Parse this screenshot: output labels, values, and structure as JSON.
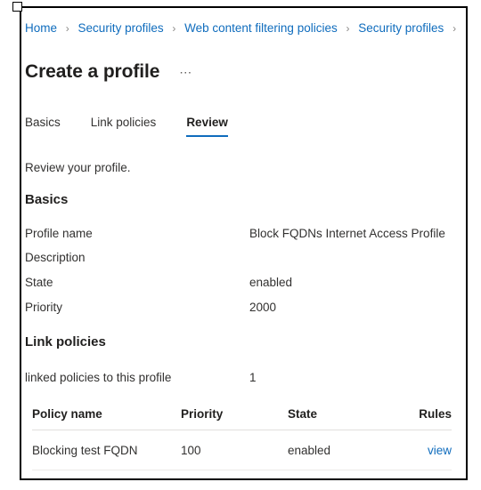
{
  "window": {
    "frame_color": "#000000",
    "accent_color": "#0f6cbd"
  },
  "breadcrumb": {
    "items": [
      {
        "label": "Home"
      },
      {
        "label": "Security profiles"
      },
      {
        "label": "Web content filtering policies"
      },
      {
        "label": "Security profiles"
      }
    ],
    "separator": "›",
    "trailing_separator": "›"
  },
  "header": {
    "title": "Create a profile",
    "more_label": "⋯"
  },
  "tabs": [
    {
      "label": "Basics",
      "active": false
    },
    {
      "label": "Link policies",
      "active": false
    },
    {
      "label": "Review",
      "active": true
    }
  ],
  "main": {
    "intro": "Review your profile.",
    "basics": {
      "heading": "Basics",
      "rows": [
        {
          "key": "Profile name",
          "value": "Block FQDNs Internet Access Profile"
        },
        {
          "key": "Description",
          "value": ""
        },
        {
          "key": "State",
          "value": "enabled"
        },
        {
          "key": "Priority",
          "value": "2000"
        }
      ]
    },
    "link_policies": {
      "heading": "Link policies",
      "summary": {
        "key": "linked policies to this profile",
        "value": "1"
      },
      "table": {
        "columns": [
          "Policy name",
          "Priority",
          "State",
          "Rules"
        ],
        "rows": [
          {
            "policy_name": "Blocking test FQDN",
            "priority": "100",
            "state": "enabled",
            "rules_link": "view"
          }
        ]
      }
    }
  }
}
